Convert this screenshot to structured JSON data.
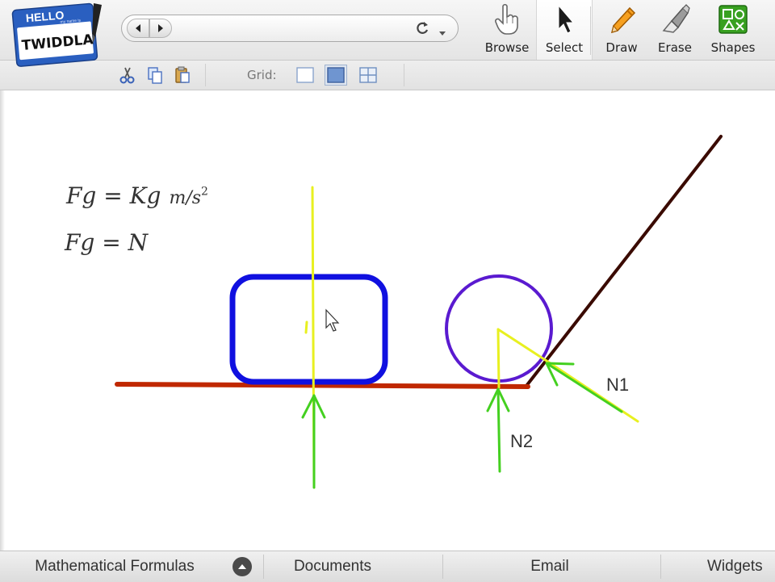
{
  "app": {
    "logo_top": "HELLO",
    "logo_small": "my name is",
    "logo_name": "TWIDDLA"
  },
  "navbar": {
    "url_value": "",
    "url_placeholder": ""
  },
  "tools": [
    {
      "label": "Browse",
      "icon": "hand-pointer-icon"
    },
    {
      "label": "Select",
      "icon": "arrow-cursor-icon"
    },
    {
      "label": "Draw",
      "icon": "pencil-icon"
    },
    {
      "label": "Erase",
      "icon": "eraser-icon"
    },
    {
      "label": "Shapes",
      "icon": "shapes-icon"
    }
  ],
  "active_tool": "Select",
  "subbar": {
    "edit_icons": [
      "cut-icon",
      "copy-icon",
      "paste-icon"
    ],
    "grid_label": "Grid:",
    "grid_options": [
      "none",
      "fill",
      "lines"
    ],
    "grid_selected": "fill"
  },
  "canvas": {
    "formula_1": {
      "lhs": "Fg = Kg",
      "unit": "m/s",
      "exp": "2"
    },
    "formula_2": "Fg = N",
    "label_n1": "N1",
    "label_n2": "N2",
    "colors": {
      "box": "#1010e0",
      "circle": "#5a1ad0",
      "ground": "#c02800",
      "ramp": "#3a0a00",
      "yellow": "#e8f020",
      "green": "#44d020"
    }
  },
  "bottom_tabs": [
    {
      "label": "Mathematical Formulas"
    },
    {
      "label": "Documents"
    },
    {
      "label": "Email"
    },
    {
      "label": "Widgets"
    }
  ]
}
